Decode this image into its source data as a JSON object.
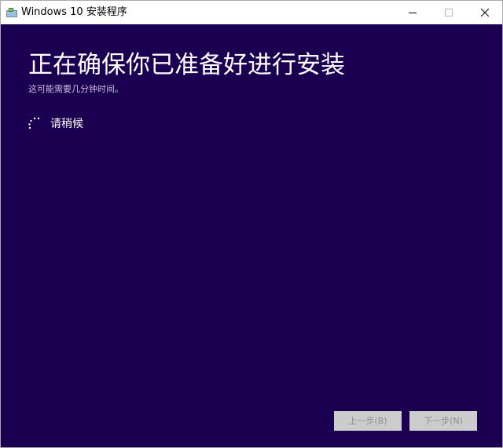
{
  "window": {
    "title": "Windows 10 安装程序",
    "icons": {
      "app": "setup-app-icon",
      "minimize": "minimize-icon",
      "maximize": "maximize-icon",
      "close": "close-icon"
    }
  },
  "main": {
    "heading": "正在确保你已准备好进行安装",
    "subheading": "这可能需要几分钟时间。",
    "status_text": "请稍候",
    "spinner_icon": "loading-spinner-icon",
    "background_color": "#1b0052"
  },
  "footer": {
    "back_label": "上一步(B)",
    "next_label": "下一步(N)",
    "buttons_enabled": false
  }
}
